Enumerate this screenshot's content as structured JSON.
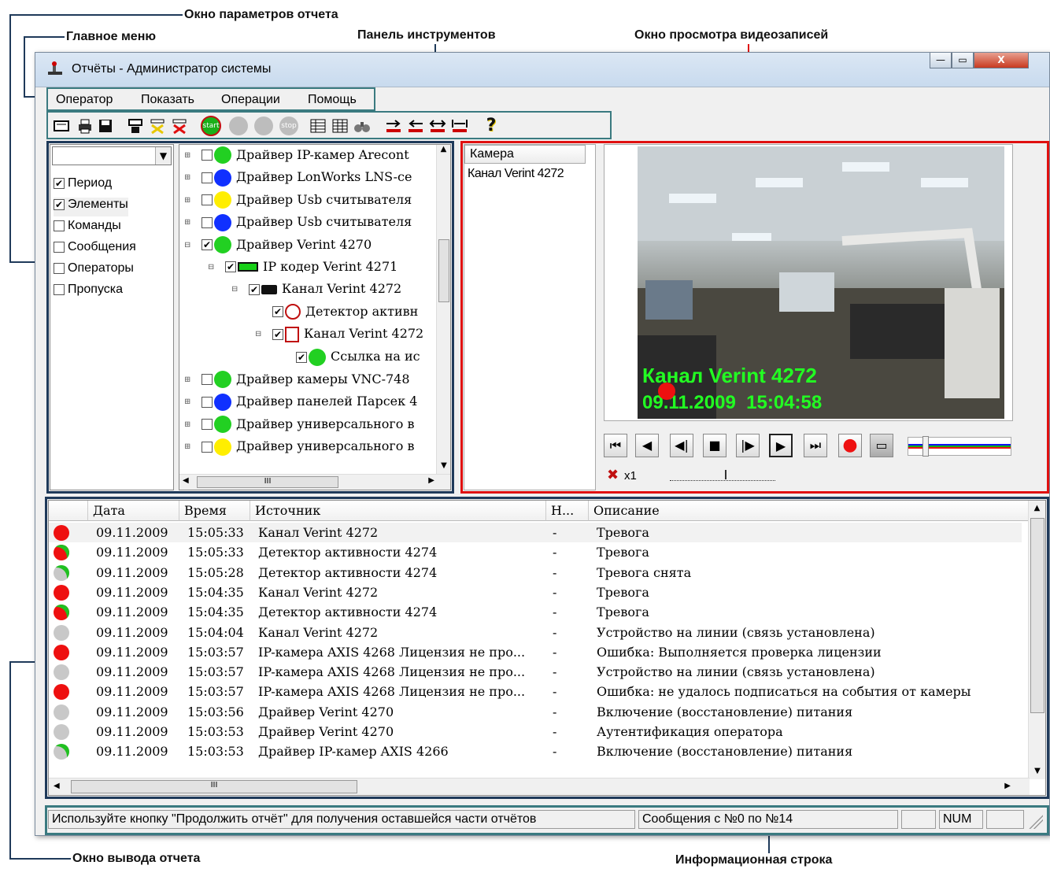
{
  "callouts": {
    "report_params": "Окно параметров отчета",
    "main_menu": "Главное меню",
    "toolbar": "Панель инструментов",
    "video_view": "Окно просмотра видеозаписей",
    "report_output": "Окно вывода отчета",
    "info_line": "Информационная строка"
  },
  "window": {
    "title": "Отчёты - Администратор системы",
    "minimize": "—",
    "maximize": "▭",
    "close": "X"
  },
  "menu": [
    "Оператор",
    "Показать",
    "Операции",
    "Помощь"
  ],
  "toolbar_icons": [
    "report-params-icon",
    "print-icon",
    "save-icon",
    "filter-icon",
    "filter-clear-icon",
    "filter-delete-icon",
    "start-icon",
    "record-icon",
    "pause-icon",
    "stop-icon",
    "columns-icon",
    "details-icon",
    "binoculars-icon",
    "arrow-right-icon",
    "arrow-left-icon",
    "arrows-both-icon",
    "arrows-bounds-icon",
    "help-icon"
  ],
  "toolbar_labels": {
    "start": "start",
    "stop": "stop",
    "help": "?"
  },
  "params": {
    "dropdown_value": "",
    "items": [
      {
        "label": "Период",
        "checked": true
      },
      {
        "label": "Элементы",
        "checked": true
      },
      {
        "label": "Команды",
        "checked": false
      },
      {
        "label": "Сообщения",
        "checked": false
      },
      {
        "label": "Операторы",
        "checked": false
      },
      {
        "label": "Пропуска",
        "checked": false
      }
    ]
  },
  "tree": [
    {
      "label": "Драйвер IP-камер Arecont",
      "color": "#22d022",
      "checked": false,
      "level": 0
    },
    {
      "label": "Драйвер LonWorks LNS-ce",
      "color": "#1030ff",
      "checked": false,
      "level": 0
    },
    {
      "label": "Драйвер Usb считывателя",
      "color": "#ffee00",
      "checked": false,
      "level": 0
    },
    {
      "label": "Драйвер Usb считывателя",
      "color": "#1030ff",
      "checked": false,
      "level": 0
    },
    {
      "label": "Драйвер Verint 4270",
      "color": "#22d022",
      "checked": true,
      "level": 0
    },
    {
      "label": "IP кодер Verint 4271",
      "color": "",
      "checked": true,
      "level": 1
    },
    {
      "label": "Канал Verint 4272",
      "color": "",
      "checked": true,
      "level": 2
    },
    {
      "label": "Детектор активн",
      "color": "",
      "checked": true,
      "level": 3
    },
    {
      "label": "Канал Verint 4272",
      "color": "",
      "checked": true,
      "level": 3
    },
    {
      "label": "Ссылка на ис",
      "color": "#22d022",
      "checked": true,
      "level": 4
    },
    {
      "label": "Драйвер камеры VNC-748",
      "color": "#22d022",
      "checked": false,
      "level": 0
    },
    {
      "label": "Драйвер панелей Парсек 4",
      "color": "#1030ff",
      "checked": false,
      "level": 0
    },
    {
      "label": "Драйвер универсального в",
      "color": "#22d022",
      "checked": false,
      "level": 0
    },
    {
      "label": "Драйвер универсального в",
      "color": "#ffee00",
      "checked": false,
      "level": 0
    }
  ],
  "tree_scroll_label": "III",
  "camera_list": {
    "header": "Камера",
    "items": [
      "Канал Verint 4272"
    ]
  },
  "video": {
    "overlay_title": "Канал Verint 4272",
    "overlay_time": "09.11.2009  15:04:58",
    "speed": "x1"
  },
  "report": {
    "columns": [
      "",
      "Дата",
      "Время",
      "Источник",
      "Н...",
      "Описание"
    ],
    "rows": [
      {
        "sev": "#ee1010",
        "flag": false,
        "date": "09.11.2009",
        "time": "15:05:33",
        "source": "Канал Verint 4272",
        "n": "-",
        "desc": "Тревога"
      },
      {
        "sev": "#ee1010",
        "flag": true,
        "date": "09.11.2009",
        "time": "15:05:33",
        "source": "Детектор активности 4274",
        "n": "-",
        "desc": "Тревога"
      },
      {
        "sev": "#c8c8c8",
        "flag": true,
        "date": "09.11.2009",
        "time": "15:05:28",
        "source": "Детектор активности 4274",
        "n": "-",
        "desc": "Тревога снята"
      },
      {
        "sev": "#ee1010",
        "flag": false,
        "date": "09.11.2009",
        "time": "15:04:35",
        "source": "Канал Verint 4272",
        "n": "-",
        "desc": "Тревога"
      },
      {
        "sev": "#ee1010",
        "flag": true,
        "date": "09.11.2009",
        "time": "15:04:35",
        "source": "Детектор активности 4274",
        "n": "-",
        "desc": "Тревога"
      },
      {
        "sev": "#c8c8c8",
        "flag": false,
        "date": "09.11.2009",
        "time": "15:04:04",
        "source": "Канал Verint 4272",
        "n": "-",
        "desc": "Устройство на линии (связь установлена)"
      },
      {
        "sev": "#ee1010",
        "flag": false,
        "date": "09.11.2009",
        "time": "15:03:57",
        "source": "IP-камера AXIS 4268 Лицензия не про...",
        "n": "-",
        "desc": "Ошибка: Выполняется проверка лицензии"
      },
      {
        "sev": "#c8c8c8",
        "flag": false,
        "date": "09.11.2009",
        "time": "15:03:57",
        "source": "IP-камера AXIS 4268 Лицензия не про...",
        "n": "-",
        "desc": "Устройство на линии (связь установлена)"
      },
      {
        "sev": "#ee1010",
        "flag": false,
        "date": "09.11.2009",
        "time": "15:03:57",
        "source": "IP-камера AXIS 4268 Лицензия не про...",
        "n": "-",
        "desc": "Ошибка: не удалось подписаться на события от камеры"
      },
      {
        "sev": "#c8c8c8",
        "flag": false,
        "date": "09.11.2009",
        "time": "15:03:56",
        "source": "Драйвер Verint 4270",
        "n": "-",
        "desc": "Включение (восстановление) питания"
      },
      {
        "sev": "#c8c8c8",
        "flag": false,
        "date": "09.11.2009",
        "time": "15:03:53",
        "source": "Драйвер Verint 4270",
        "n": "-",
        "desc": "Аутентификация оператора"
      },
      {
        "sev": "#c8c8c8",
        "flag": true,
        "date": "09.11.2009",
        "time": "15:03:53",
        "source": "Драйвер IP-камер AXIS 4266",
        "n": "-",
        "desc": "Включение (восстановление) питания"
      }
    ],
    "scroll_label": "III"
  },
  "status": {
    "hint": "Используйте кнопку \"Продолжить отчёт\" для получения оставшейся части отчётов",
    "messages": "Сообщения с №0 по  №14",
    "num": "NUM"
  }
}
